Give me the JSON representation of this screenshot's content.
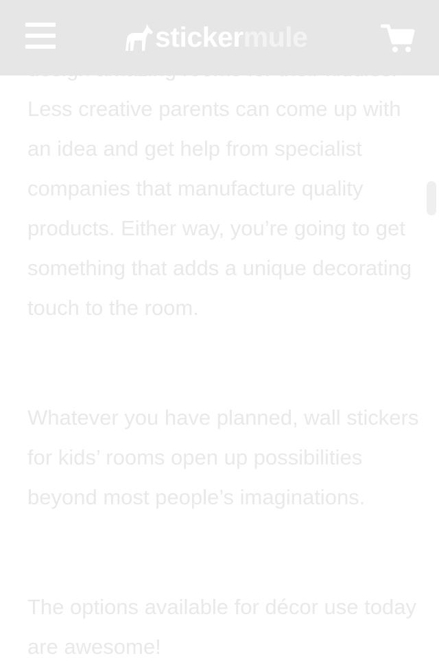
{
  "header": {
    "menu_icon": "hamburger-menu-icon",
    "logo_icon": "mule-icon",
    "logo_part1": "sticker",
    "logo_part2": "mule",
    "cart_icon": "shopping-cart-icon",
    "background_color": "#e6e6e6"
  },
  "article": {
    "paragraphs": [
      "design amazing rooms for their kiddies. Less creative parents can come up with an idea and get help from specialist companies that manufacture quality products. Either way, you’re going to get something that adds a unique decorating touch to the room.",
      "Whatever you have planned, wall stickers for kids’ rooms open up possibilities beyond most people’s imaginations.",
      "The options available for décor use today are awesome!"
    ],
    "text_color": "#e9e9e9"
  }
}
